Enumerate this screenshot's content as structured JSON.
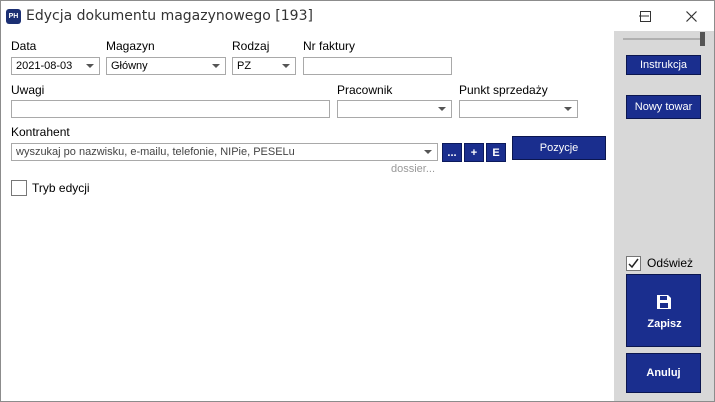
{
  "window": {
    "app_icon_text": "PH",
    "title": "Edycja dokumentu magazynowego [193]"
  },
  "form": {
    "data_label": "Data",
    "data_value": "2021-08-03",
    "magazyn_label": "Magazyn",
    "magazyn_value": "Główny",
    "rodzaj_label": "Rodzaj",
    "rodzaj_value": "PZ",
    "nr_faktury_label": "Nr faktury",
    "nr_faktury_value": "",
    "uwagi_label": "Uwagi",
    "uwagi_value": "",
    "pracownik_label": "Pracownik",
    "pracownik_value": "",
    "punkt_label": "Punkt sprzedaży",
    "punkt_value": "",
    "kontrahent_label": "Kontrahent",
    "kontrahent_placeholder": "wyszukaj po nazwisku, e-mailu, telefonie, NIPie, PESELu",
    "btn_more": "...",
    "btn_add": "+",
    "btn_edit": "E",
    "dossier_link": "dossier...",
    "pozycje_button": "Pozycje",
    "tryb_edycji_label": "Tryb edycji",
    "tryb_edycji_checked": false
  },
  "sidebar": {
    "instrukcja_button": "Instrukcja",
    "nowy_towar_button": "Nowy towar",
    "odswiez_label": "Odśwież",
    "odswiez_checked": true,
    "zapisz_button": "Zapisz",
    "anuluj_button": "Anuluj"
  },
  "colors": {
    "button_primary": "#1a2e8e",
    "panel_bg": "#d8d8d8"
  }
}
